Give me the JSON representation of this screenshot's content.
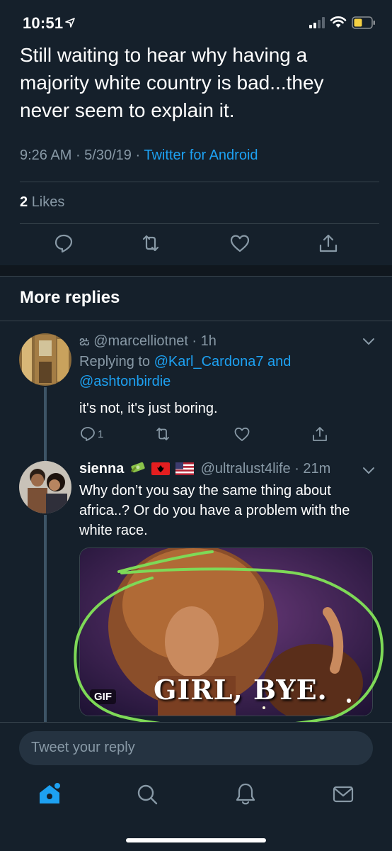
{
  "status": {
    "time": "10:51"
  },
  "tweet": {
    "text": "Still waiting to hear why having a majority white country is bad...they never seem to explain it.",
    "time": "9:26 AM",
    "date": "5/30/19",
    "source": "Twitter for Android",
    "likes_count": "2",
    "likes_label": "Likes"
  },
  "section": {
    "more_replies": "More replies"
  },
  "replies": [
    {
      "icon_glyph": "ఙ",
      "handle": "@marcelliotnet",
      "age": "1h",
      "replying_prefix": "Replying to",
      "replying_user1": "@Karl_Cardona7",
      "replying_and": "and",
      "replying_user2": "@ashtonbirdie",
      "text": "it's not, it's just boring.",
      "reply_count": "1"
    },
    {
      "name": "sienna",
      "handle": "@ultralust4life",
      "age": "21m",
      "text": "Why don’t you say the same thing about africa..? Or do you have a problem with the white race.",
      "gif_badge": "GIF",
      "gif_caption": "GIRL, BYE."
    }
  ],
  "compose": {
    "placeholder": "Tweet your reply"
  },
  "colors": {
    "background": "#15202b",
    "accent": "#1da1f2",
    "muted": "#8899a6",
    "annotation": "#7ed957"
  },
  "icons": [
    "location-arrow-icon",
    "signal-icon",
    "wifi-icon",
    "battery-icon",
    "reply-icon",
    "retweet-icon",
    "like-icon",
    "share-icon",
    "chevron-down-icon",
    "money-emoji-icon",
    "albania-flag-icon",
    "us-flag-icon",
    "home-icon",
    "search-icon",
    "notifications-icon",
    "messages-icon"
  ]
}
